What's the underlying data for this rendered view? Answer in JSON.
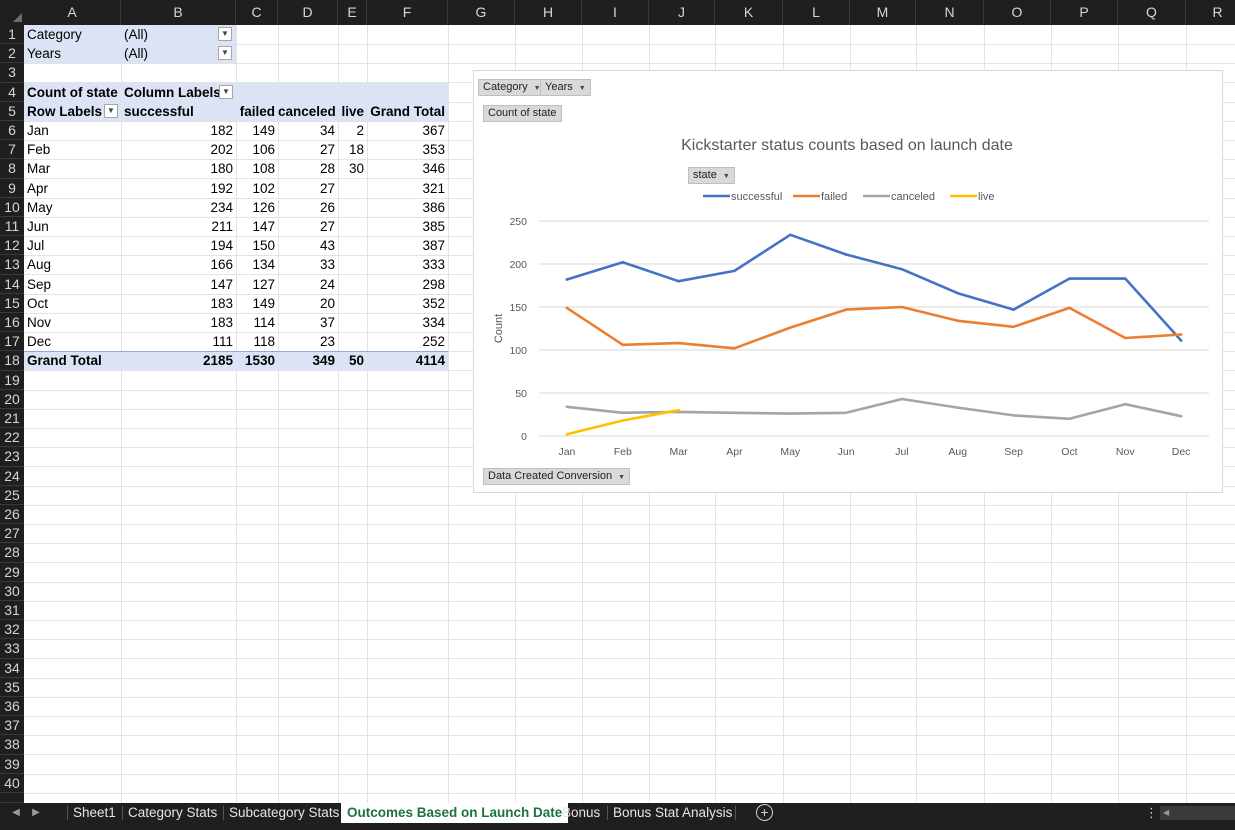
{
  "columns": [
    "A",
    "B",
    "C",
    "D",
    "E",
    "F",
    "G",
    "H",
    "I",
    "J",
    "K",
    "L",
    "M",
    "N",
    "O",
    "P",
    "Q",
    "R"
  ],
  "row_numbers": [
    "1",
    "2",
    "3",
    "4",
    "5",
    "6",
    "7",
    "8",
    "9",
    "10",
    "11",
    "12",
    "13",
    "14",
    "15",
    "16",
    "17",
    "18",
    "19",
    "20",
    "21",
    "22",
    "23",
    "24",
    "25",
    "26",
    "27",
    "28",
    "29",
    "30",
    "31",
    "32",
    "33",
    "34",
    "35",
    "36",
    "37",
    "38",
    "39",
    "40"
  ],
  "filters": [
    {
      "label": "Category",
      "value": "(All)"
    },
    {
      "label": "Years",
      "value": "(All)"
    }
  ],
  "pivot": {
    "count_label": "Count of state",
    "column_labels": "Column Labels",
    "row_labels": "Row Labels",
    "headers": [
      "successful",
      "failed",
      "canceled",
      "live",
      "Grand Total"
    ],
    "rows": [
      [
        "Jan",
        "182",
        "149",
        "34",
        "2",
        "367"
      ],
      [
        "Feb",
        "202",
        "106",
        "27",
        "18",
        "353"
      ],
      [
        "Mar",
        "180",
        "108",
        "28",
        "30",
        "346"
      ],
      [
        "Apr",
        "192",
        "102",
        "27",
        "",
        "321"
      ],
      [
        "May",
        "234",
        "126",
        "26",
        "",
        "386"
      ],
      [
        "Jun",
        "211",
        "147",
        "27",
        "",
        "385"
      ],
      [
        "Jul",
        "194",
        "150",
        "43",
        "",
        "387"
      ],
      [
        "Aug",
        "166",
        "134",
        "33",
        "",
        "333"
      ],
      [
        "Sep",
        "147",
        "127",
        "24",
        "",
        "298"
      ],
      [
        "Oct",
        "183",
        "149",
        "20",
        "",
        "352"
      ],
      [
        "Nov",
        "183",
        "114",
        "37",
        "",
        "334"
      ],
      [
        "Dec",
        "111",
        "118",
        "23",
        "",
        "252"
      ]
    ],
    "total": [
      "Grand Total",
      "2185",
      "1530",
      "349",
      "50",
      "4114"
    ]
  },
  "chart_buttons": {
    "category": "Category",
    "years": "Years",
    "count_of_state": "Count of state",
    "state": "state",
    "axis_field": "Data Created Conversion"
  },
  "chart_data": {
    "type": "line",
    "title": "Kickstarter status counts based on launch date",
    "xlabel": "",
    "ylabel": "Count",
    "categories": [
      "Jan",
      "Feb",
      "Mar",
      "Apr",
      "May",
      "Jun",
      "Jul",
      "Aug",
      "Sep",
      "Oct",
      "Nov",
      "Dec"
    ],
    "ylim": [
      0,
      250
    ],
    "yticks": [
      0,
      50,
      100,
      150,
      200,
      250
    ],
    "grid": true,
    "legend": "top",
    "series": [
      {
        "name": "successful",
        "color": "#4472c4",
        "values": [
          182,
          202,
          180,
          192,
          234,
          211,
          194,
          166,
          147,
          183,
          183,
          111
        ]
      },
      {
        "name": "failed",
        "color": "#ed7d31",
        "values": [
          149,
          106,
          108,
          102,
          126,
          147,
          150,
          134,
          127,
          149,
          114,
          118
        ]
      },
      {
        "name": "canceled",
        "color": "#a5a5a5",
        "values": [
          34,
          27,
          28,
          27,
          26,
          27,
          43,
          33,
          24,
          20,
          37,
          23
        ]
      },
      {
        "name": "live",
        "color": "#ffc000",
        "values": [
          2,
          18,
          30,
          null,
          null,
          null,
          null,
          null,
          null,
          null,
          null,
          null
        ]
      }
    ]
  },
  "tabs": [
    "Sheet1",
    "Category Stats",
    "Subcategory Stats",
    "Outcomes Based on Launch Date",
    "Bonus",
    "Bonus Stat Analysis"
  ],
  "active_tab": "Outcomes Based on Launch Date",
  "add_sheet_symbol": "+",
  "colors": {
    "header_bg": "#1f1f1f",
    "pivot_highlight": "#dce3f5",
    "active_tab_text": "#1e7145"
  }
}
